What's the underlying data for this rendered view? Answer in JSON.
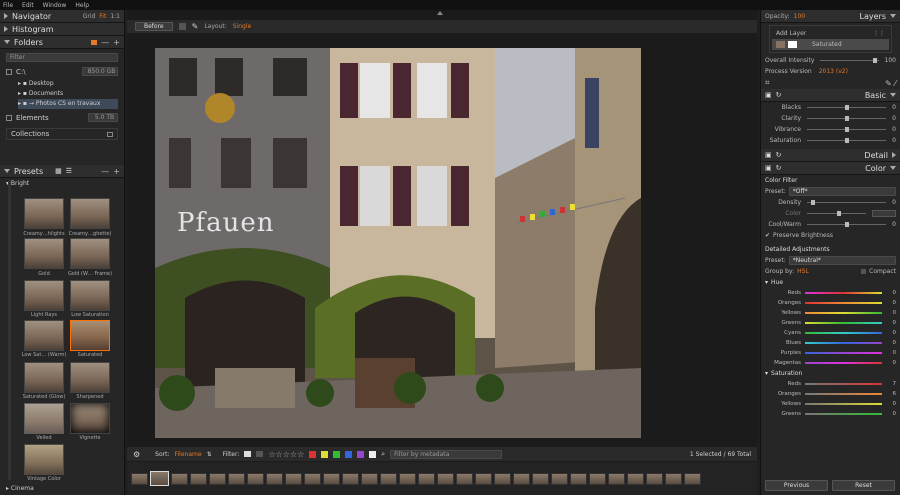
{
  "menu": [
    "File",
    "Edit",
    "Window",
    "Help"
  ],
  "left": {
    "navigator": {
      "label": "Navigator",
      "grid": "Grid",
      "fit": "Fit",
      "one": "1:1"
    },
    "histogram": "Histogram",
    "folders": {
      "label": "Folders",
      "filter_placeholder": "Filter",
      "drive": "C:\\",
      "drive_size": "850.0 GB",
      "items": [
        "Desktop",
        "Documents",
        "→ Photos CS en travaux"
      ],
      "elements_label": "Elements",
      "elements_size": "5.0 TB",
      "collections": "Collections"
    },
    "presets": {
      "label": "Presets",
      "group": "Bright",
      "items": [
        "Creamy…hlights",
        "Creamy…ghette)",
        "Gold",
        "Gold (W… Frame)",
        "Light Rays",
        "Low Saturation",
        "Low Sat… (Warm)",
        "Saturated",
        "Saturated (Glow)",
        "Sharpened",
        "Veiled",
        "Vignette",
        "Vintage Color"
      ],
      "next_group": "Cinema"
    }
  },
  "center": {
    "before_label": "Before",
    "layout_label": "Layout:",
    "layout_value": "Single",
    "sort_label": "Sort:",
    "sort_value": "Filename",
    "filter_label": "Filter:",
    "stars": "☆☆☆☆☆",
    "metadata_placeholder": "Filter by metadata",
    "selection_status": "1 Selected / 69 Total",
    "shop_sign": "Pfauen"
  },
  "right": {
    "layers": {
      "label": "Layers",
      "opacity_label": "Opacity:",
      "opacity_value": "100",
      "add_layer": "Add Layer",
      "layer_name": "Saturated",
      "overall_label": "Overall Intensity",
      "overall_value": "100",
      "process_label": "Process Version",
      "process_value": "2013 (v2)"
    },
    "basic": {
      "label": "Basic",
      "rows": [
        {
          "name": "Blacks",
          "value": "0"
        },
        {
          "name": "Clarity",
          "value": "0"
        },
        {
          "name": "Vibrance",
          "value": "0"
        },
        {
          "name": "Saturation",
          "value": "0"
        }
      ]
    },
    "detail": "Detail",
    "color": {
      "label": "Color",
      "filter_title": "Color Filter",
      "preset_label": "Preset:",
      "preset_value": "*Off*",
      "density_label": "Density",
      "density_value": "0",
      "color_label": "Color",
      "coolwarm_label": "Cool/Warm",
      "coolwarm_value": "0",
      "preserve": "Preserve Brightness",
      "detailed_title": "Detailed Adjustments",
      "detailed_preset": "*Neutral*",
      "groupby_label": "Group by:",
      "groupby_value": "HSL",
      "compact": "Compact",
      "hue_title": "Hue",
      "hue_rows": [
        {
          "name": "Reds",
          "value": "0"
        },
        {
          "name": "Oranges",
          "value": "0"
        },
        {
          "name": "Yellows",
          "value": "0"
        },
        {
          "name": "Greens",
          "value": "0"
        },
        {
          "name": "Cyans",
          "value": "0"
        },
        {
          "name": "Blues",
          "value": "0"
        },
        {
          "name": "Purples",
          "value": "0"
        },
        {
          "name": "Magentas",
          "value": "0"
        }
      ],
      "sat_title": "Saturation",
      "sat_rows": [
        {
          "name": "Reds",
          "value": "7"
        },
        {
          "name": "Oranges",
          "value": "6"
        },
        {
          "name": "Yellows",
          "value": "0"
        },
        {
          "name": "Greens",
          "value": "0"
        }
      ]
    },
    "previous": "Previous",
    "reset": "Reset"
  },
  "colors": {
    "accent": "#e47a2a",
    "panel": "#262626",
    "header": "#2e2e2e"
  }
}
